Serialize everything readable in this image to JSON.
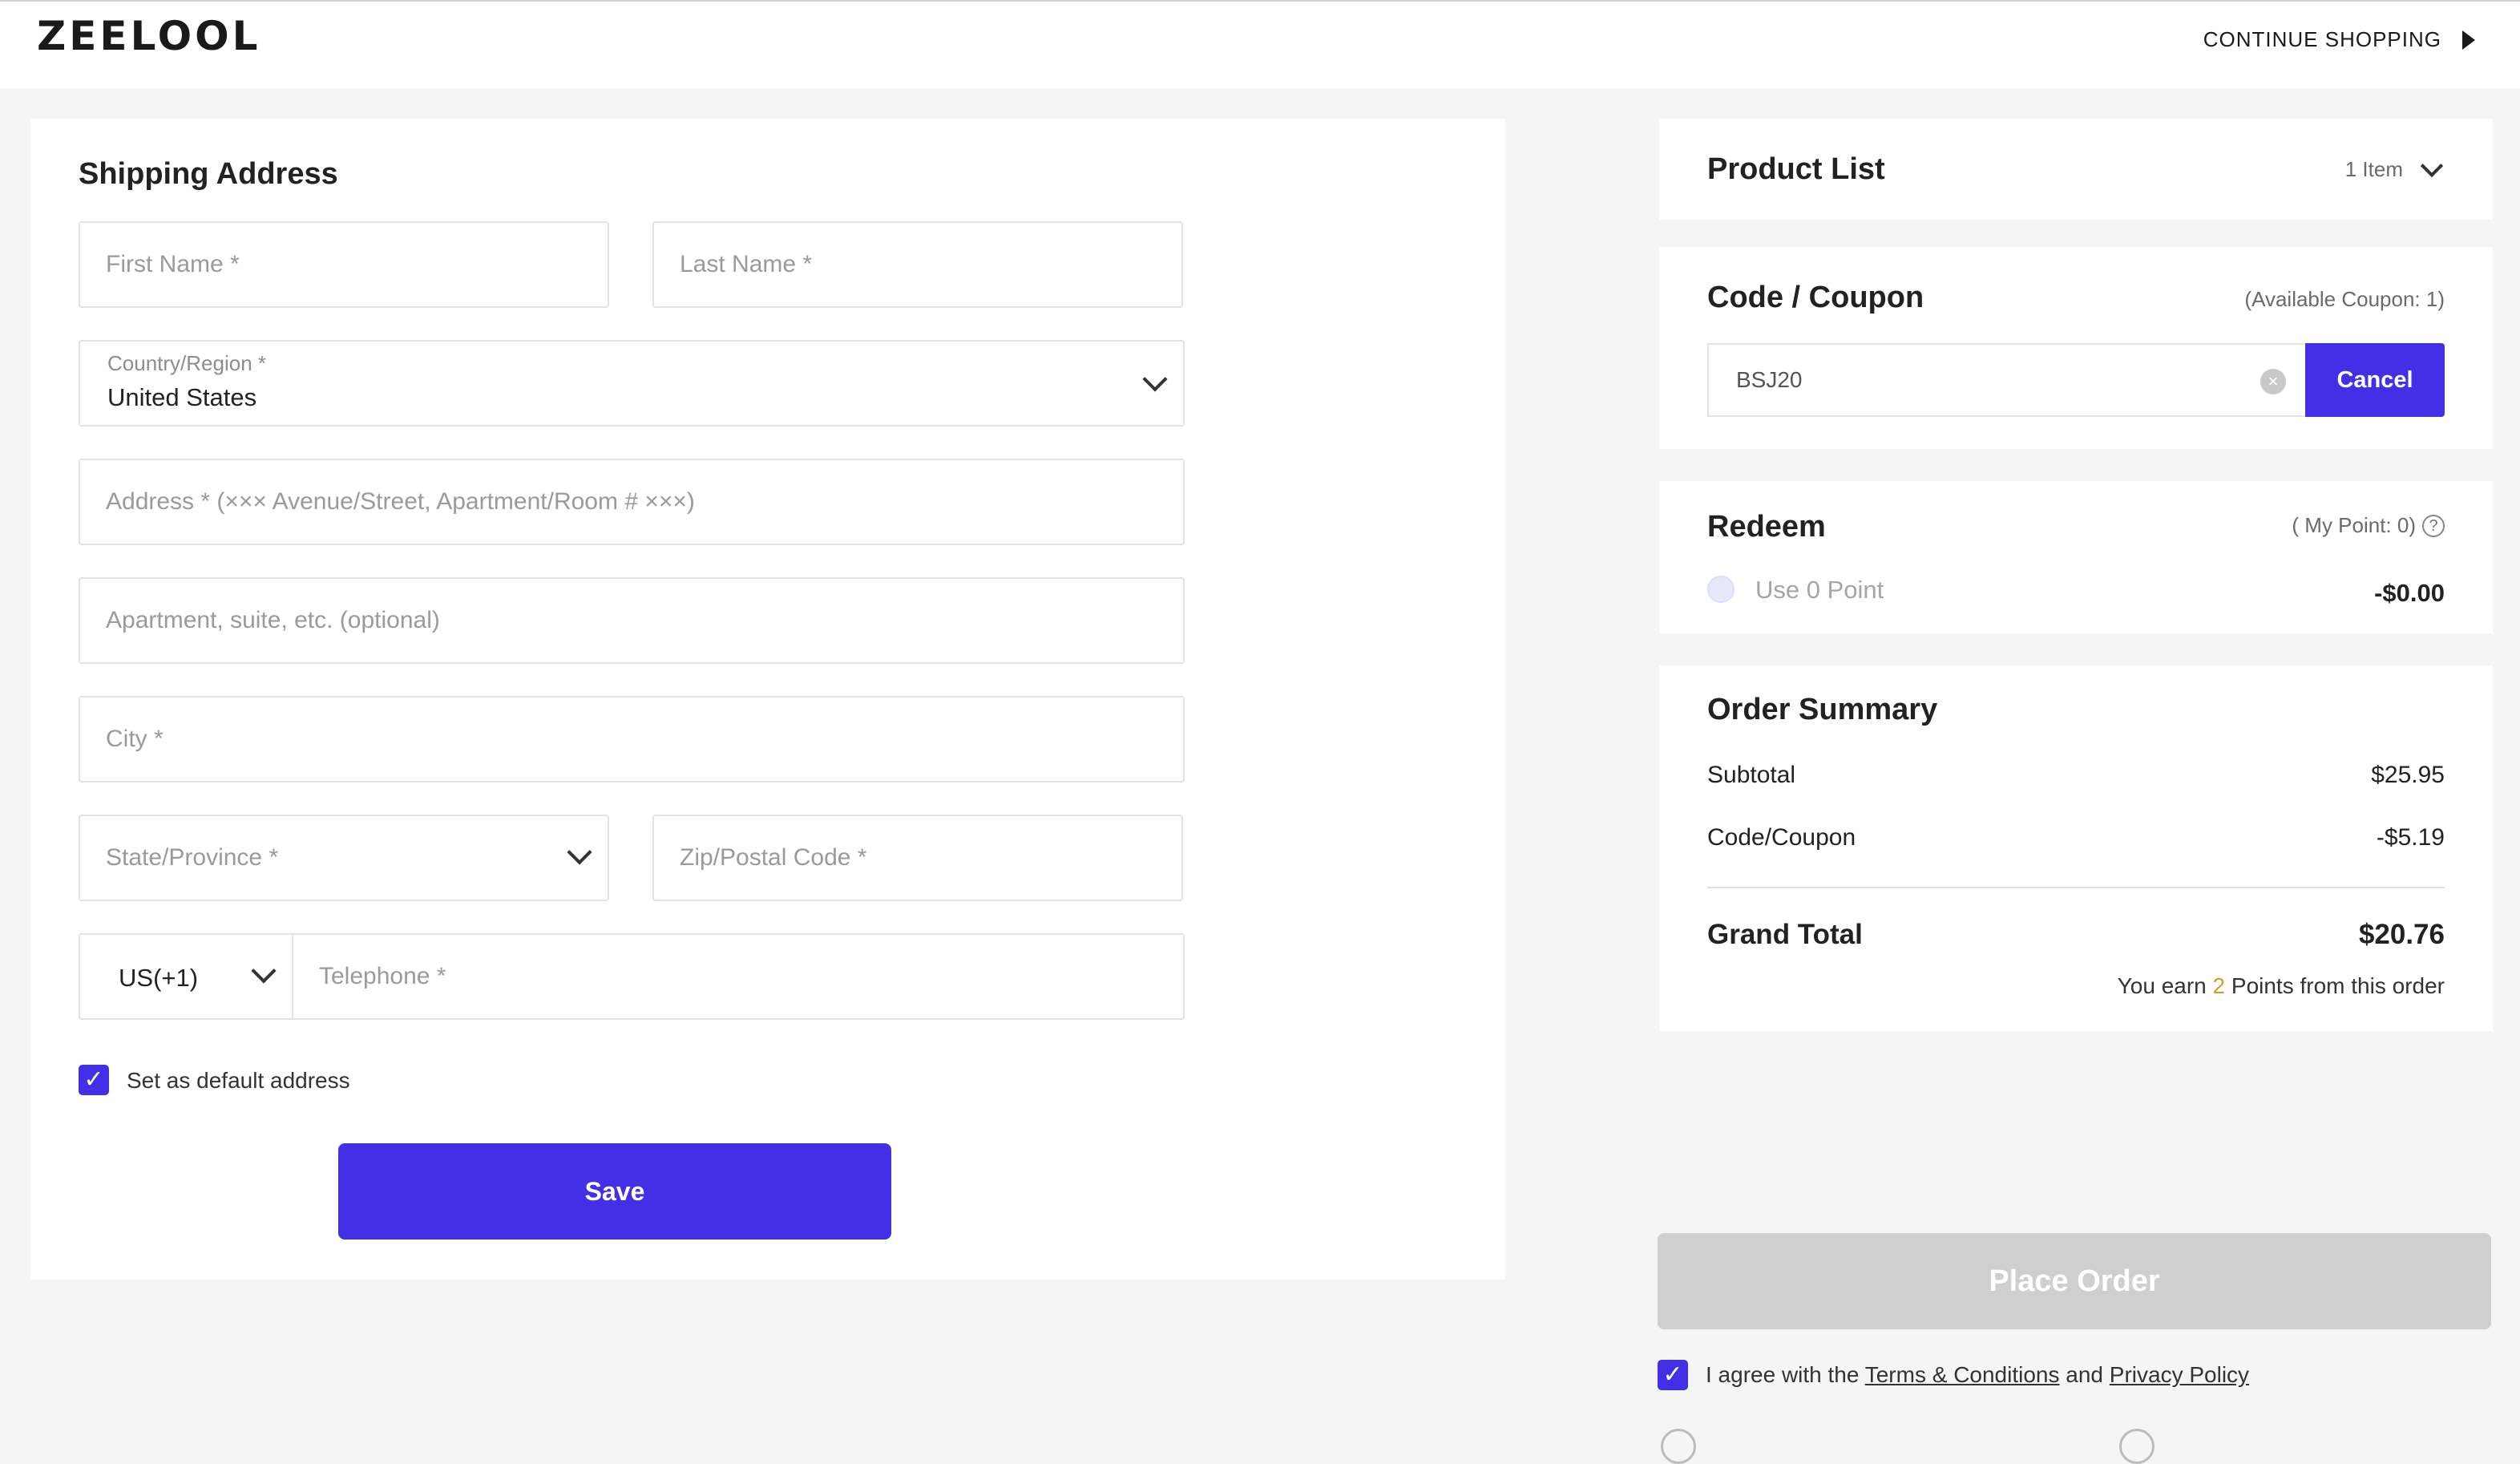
{
  "header": {
    "logo": "ZEELOOL",
    "continue_label": "CONTINUE SHOPPING"
  },
  "shipping": {
    "title": "Shipping Address",
    "first_name_placeholder": "First Name *",
    "last_name_placeholder": "Last Name *",
    "country_label": "Country/Region *",
    "country_value": "United States",
    "address_placeholder": "Address * (××× Avenue/Street, Apartment/Room # ×××)",
    "apartment_placeholder": "Apartment, suite, etc. (optional)",
    "city_placeholder": "City *",
    "state_placeholder": "State/Province *",
    "zip_placeholder": "Zip/Postal Code *",
    "phone_code": "US(+1)",
    "telephone_placeholder": "Telephone *",
    "default_address_label": "Set as default address",
    "default_address_checked": true,
    "save_label": "Save"
  },
  "product_list": {
    "title": "Product List",
    "count_label": "1 Item"
  },
  "coupon": {
    "title": "Code / Coupon",
    "available_label": "(Available Coupon: 1)",
    "code_value": "BSJ20",
    "cancel_label": "Cancel"
  },
  "redeem": {
    "title": "Redeem",
    "my_point_label": "( My Point: 0)",
    "use_point_label": "Use 0 Point",
    "amount": "-$0.00"
  },
  "order_summary": {
    "title": "Order Summary",
    "subtotal_label": "Subtotal",
    "subtotal_value": "$25.95",
    "coupon_label": "Code/Coupon",
    "coupon_value": "-$5.19",
    "grand_total_label": "Grand Total",
    "grand_total_value": "$20.76",
    "earn_prefix": "You earn",
    "earn_points": "2",
    "earn_suffix": "Points from this order"
  },
  "place_order_label": "Place Order",
  "agree": {
    "prefix": "I agree with the",
    "terms": "Terms & Conditions",
    "and": "and",
    "privacy": "Privacy Policy"
  },
  "colors": {
    "accent": "#4330e6",
    "disabled": "#cfcfcf"
  }
}
